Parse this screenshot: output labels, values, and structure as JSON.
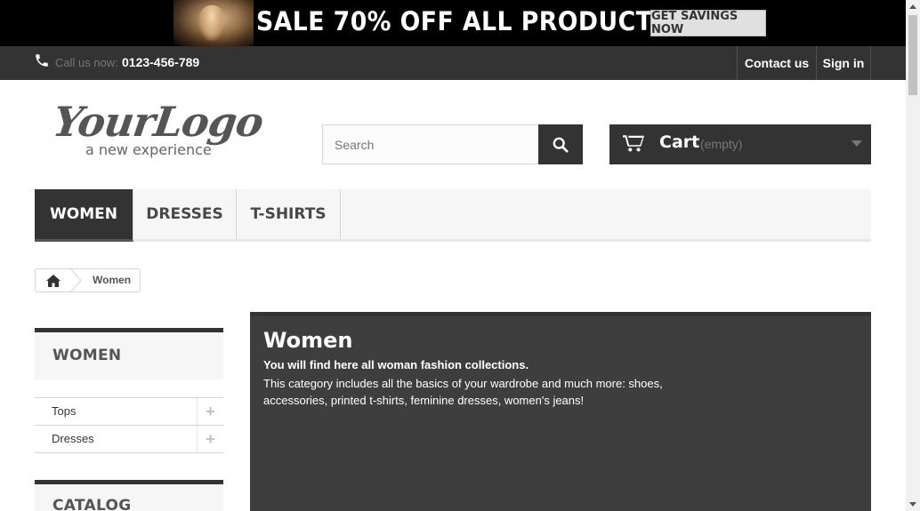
{
  "promo": {
    "text": "SALE 70% OFF ALL PRODUCTS",
    "button_label": "GET SAVINGS NOW"
  },
  "topnav": {
    "phone_icon": "phone-icon",
    "call_label": "Call us now:",
    "phone_number": "0123-456-789",
    "contact_label": "Contact us",
    "signin_label": "Sign in"
  },
  "logo": {
    "main": "YourLogo",
    "tagline": "a new experience"
  },
  "search": {
    "placeholder": "Search",
    "value": "",
    "icon": "search-icon"
  },
  "cart": {
    "label": "Cart",
    "status": "(empty)",
    "icon": "cart-icon"
  },
  "menu": {
    "items": [
      {
        "label": "WOMEN",
        "active": true
      },
      {
        "label": "DRESSES",
        "active": false
      },
      {
        "label": "T-SHIRTS",
        "active": false
      }
    ]
  },
  "breadcrumb": {
    "home_icon": "home-icon",
    "current": "Women"
  },
  "sidebar": {
    "women_title": "WOMEN",
    "items": [
      {
        "label": "Tops",
        "expander": "+"
      },
      {
        "label": "Dresses",
        "expander": "+"
      }
    ],
    "catalog_title": "CATALOG"
  },
  "category": {
    "title": "Women",
    "subtitle": "You will find here all woman fashion collections.",
    "description": "This category includes all the basics of your wardrobe and much more: shoes, accessories, printed t-shirts, feminine dresses, women's jeans!"
  },
  "colors": {
    "dark": "#333333",
    "panel": "#3e3e3e",
    "menu_bg": "#f6f6f6",
    "border": "#d6d4d4"
  }
}
